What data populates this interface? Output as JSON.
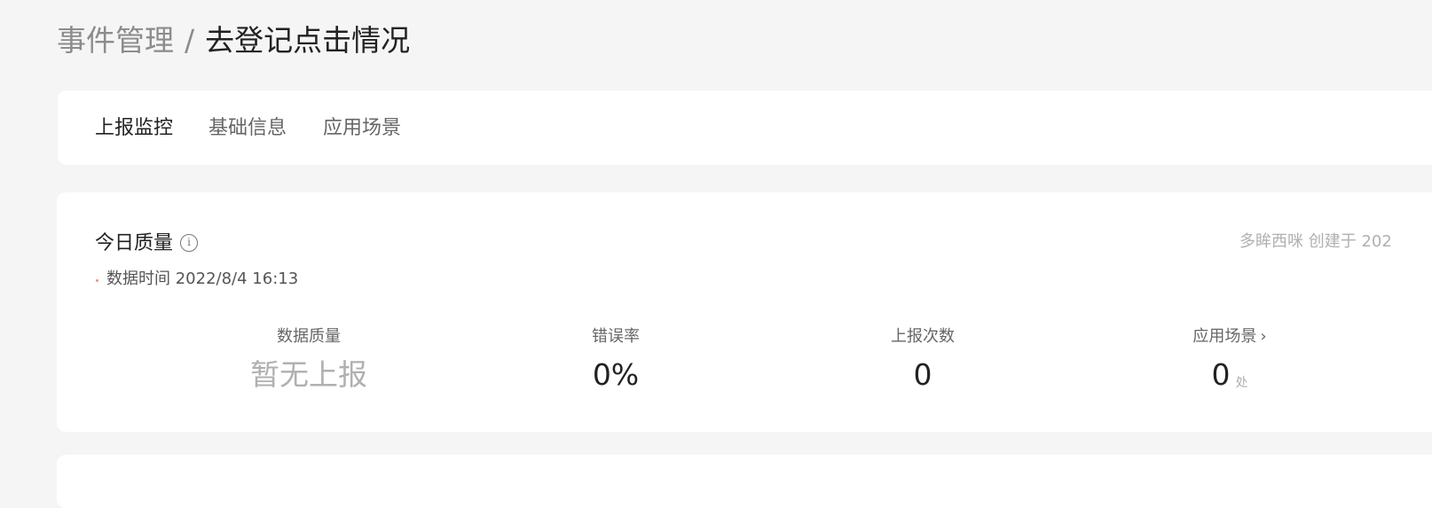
{
  "breadcrumb": {
    "parent": "事件管理",
    "separator": "/",
    "current": "去登记点击情况"
  },
  "tabs": [
    {
      "label": "上报监控",
      "active": true
    },
    {
      "label": "基础信息",
      "active": false
    },
    {
      "label": "应用场景",
      "active": false
    }
  ],
  "quality": {
    "title": "今日质量",
    "info_icon": "info-icon",
    "data_time": "数据时间 2022/8/4 16:13",
    "creator": "多眸西咪 创建于 202",
    "metrics": [
      {
        "label": "数据质量",
        "value": "暂无上报"
      },
      {
        "label": "错误率",
        "value": "0%"
      },
      {
        "label": "上报次数",
        "value": "0"
      },
      {
        "label": "应用场景",
        "value": "0",
        "unit": "处",
        "chevron": "›"
      }
    ]
  },
  "colors": {
    "background": "#f5f5f5",
    "card": "#ffffff",
    "muted_text": "#8c8c8c",
    "dot": "#f28b82"
  }
}
